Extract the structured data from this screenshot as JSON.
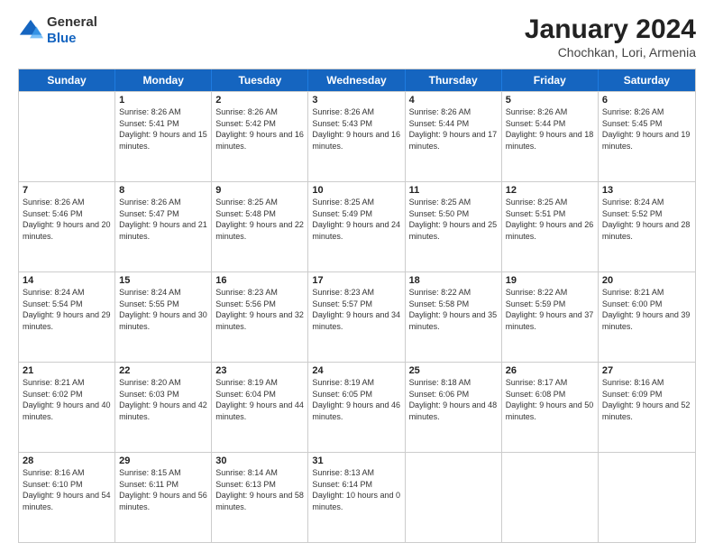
{
  "header": {
    "logo_general": "General",
    "logo_blue": "Blue",
    "title": "January 2024",
    "subtitle": "Chochkan, Lori, Armenia"
  },
  "days_of_week": [
    "Sunday",
    "Monday",
    "Tuesday",
    "Wednesday",
    "Thursday",
    "Friday",
    "Saturday"
  ],
  "weeks": [
    [
      {
        "day": "",
        "sunrise": "",
        "sunset": "",
        "daylight": ""
      },
      {
        "day": "1",
        "sunrise": "Sunrise: 8:26 AM",
        "sunset": "Sunset: 5:41 PM",
        "daylight": "Daylight: 9 hours and 15 minutes."
      },
      {
        "day": "2",
        "sunrise": "Sunrise: 8:26 AM",
        "sunset": "Sunset: 5:42 PM",
        "daylight": "Daylight: 9 hours and 16 minutes."
      },
      {
        "day": "3",
        "sunrise": "Sunrise: 8:26 AM",
        "sunset": "Sunset: 5:43 PM",
        "daylight": "Daylight: 9 hours and 16 minutes."
      },
      {
        "day": "4",
        "sunrise": "Sunrise: 8:26 AM",
        "sunset": "Sunset: 5:44 PM",
        "daylight": "Daylight: 9 hours and 17 minutes."
      },
      {
        "day": "5",
        "sunrise": "Sunrise: 8:26 AM",
        "sunset": "Sunset: 5:44 PM",
        "daylight": "Daylight: 9 hours and 18 minutes."
      },
      {
        "day": "6",
        "sunrise": "Sunrise: 8:26 AM",
        "sunset": "Sunset: 5:45 PM",
        "daylight": "Daylight: 9 hours and 19 minutes."
      }
    ],
    [
      {
        "day": "7",
        "sunrise": "Sunrise: 8:26 AM",
        "sunset": "Sunset: 5:46 PM",
        "daylight": "Daylight: 9 hours and 20 minutes."
      },
      {
        "day": "8",
        "sunrise": "Sunrise: 8:26 AM",
        "sunset": "Sunset: 5:47 PM",
        "daylight": "Daylight: 9 hours and 21 minutes."
      },
      {
        "day": "9",
        "sunrise": "Sunrise: 8:25 AM",
        "sunset": "Sunset: 5:48 PM",
        "daylight": "Daylight: 9 hours and 22 minutes."
      },
      {
        "day": "10",
        "sunrise": "Sunrise: 8:25 AM",
        "sunset": "Sunset: 5:49 PM",
        "daylight": "Daylight: 9 hours and 24 minutes."
      },
      {
        "day": "11",
        "sunrise": "Sunrise: 8:25 AM",
        "sunset": "Sunset: 5:50 PM",
        "daylight": "Daylight: 9 hours and 25 minutes."
      },
      {
        "day": "12",
        "sunrise": "Sunrise: 8:25 AM",
        "sunset": "Sunset: 5:51 PM",
        "daylight": "Daylight: 9 hours and 26 minutes."
      },
      {
        "day": "13",
        "sunrise": "Sunrise: 8:24 AM",
        "sunset": "Sunset: 5:52 PM",
        "daylight": "Daylight: 9 hours and 28 minutes."
      }
    ],
    [
      {
        "day": "14",
        "sunrise": "Sunrise: 8:24 AM",
        "sunset": "Sunset: 5:54 PM",
        "daylight": "Daylight: 9 hours and 29 minutes."
      },
      {
        "day": "15",
        "sunrise": "Sunrise: 8:24 AM",
        "sunset": "Sunset: 5:55 PM",
        "daylight": "Daylight: 9 hours and 30 minutes."
      },
      {
        "day": "16",
        "sunrise": "Sunrise: 8:23 AM",
        "sunset": "Sunset: 5:56 PM",
        "daylight": "Daylight: 9 hours and 32 minutes."
      },
      {
        "day": "17",
        "sunrise": "Sunrise: 8:23 AM",
        "sunset": "Sunset: 5:57 PM",
        "daylight": "Daylight: 9 hours and 34 minutes."
      },
      {
        "day": "18",
        "sunrise": "Sunrise: 8:22 AM",
        "sunset": "Sunset: 5:58 PM",
        "daylight": "Daylight: 9 hours and 35 minutes."
      },
      {
        "day": "19",
        "sunrise": "Sunrise: 8:22 AM",
        "sunset": "Sunset: 5:59 PM",
        "daylight": "Daylight: 9 hours and 37 minutes."
      },
      {
        "day": "20",
        "sunrise": "Sunrise: 8:21 AM",
        "sunset": "Sunset: 6:00 PM",
        "daylight": "Daylight: 9 hours and 39 minutes."
      }
    ],
    [
      {
        "day": "21",
        "sunrise": "Sunrise: 8:21 AM",
        "sunset": "Sunset: 6:02 PM",
        "daylight": "Daylight: 9 hours and 40 minutes."
      },
      {
        "day": "22",
        "sunrise": "Sunrise: 8:20 AM",
        "sunset": "Sunset: 6:03 PM",
        "daylight": "Daylight: 9 hours and 42 minutes."
      },
      {
        "day": "23",
        "sunrise": "Sunrise: 8:19 AM",
        "sunset": "Sunset: 6:04 PM",
        "daylight": "Daylight: 9 hours and 44 minutes."
      },
      {
        "day": "24",
        "sunrise": "Sunrise: 8:19 AM",
        "sunset": "Sunset: 6:05 PM",
        "daylight": "Daylight: 9 hours and 46 minutes."
      },
      {
        "day": "25",
        "sunrise": "Sunrise: 8:18 AM",
        "sunset": "Sunset: 6:06 PM",
        "daylight": "Daylight: 9 hours and 48 minutes."
      },
      {
        "day": "26",
        "sunrise": "Sunrise: 8:17 AM",
        "sunset": "Sunset: 6:08 PM",
        "daylight": "Daylight: 9 hours and 50 minutes."
      },
      {
        "day": "27",
        "sunrise": "Sunrise: 8:16 AM",
        "sunset": "Sunset: 6:09 PM",
        "daylight": "Daylight: 9 hours and 52 minutes."
      }
    ],
    [
      {
        "day": "28",
        "sunrise": "Sunrise: 8:16 AM",
        "sunset": "Sunset: 6:10 PM",
        "daylight": "Daylight: 9 hours and 54 minutes."
      },
      {
        "day": "29",
        "sunrise": "Sunrise: 8:15 AM",
        "sunset": "Sunset: 6:11 PM",
        "daylight": "Daylight: 9 hours and 56 minutes."
      },
      {
        "day": "30",
        "sunrise": "Sunrise: 8:14 AM",
        "sunset": "Sunset: 6:13 PM",
        "daylight": "Daylight: 9 hours and 58 minutes."
      },
      {
        "day": "31",
        "sunrise": "Sunrise: 8:13 AM",
        "sunset": "Sunset: 6:14 PM",
        "daylight": "Daylight: 10 hours and 0 minutes."
      },
      {
        "day": "",
        "sunrise": "",
        "sunset": "",
        "daylight": ""
      },
      {
        "day": "",
        "sunrise": "",
        "sunset": "",
        "daylight": ""
      },
      {
        "day": "",
        "sunrise": "",
        "sunset": "",
        "daylight": ""
      }
    ]
  ]
}
